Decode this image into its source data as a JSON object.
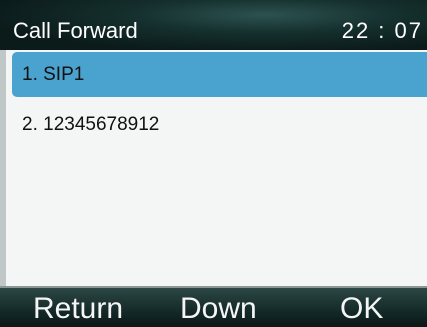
{
  "header": {
    "title": "Call Forward",
    "clock": "22 : 07"
  },
  "list": {
    "items": [
      {
        "label": "1. SIP1",
        "selected": true
      },
      {
        "label": "2. 12345678912",
        "selected": false
      }
    ]
  },
  "softkeys": {
    "left": "Return",
    "middle": "Down",
    "right": "OK"
  },
  "colors": {
    "selection": "#4aa3cf",
    "list_background": "#f4f6f5",
    "header_background": "#15302e",
    "softkey_background": "#152c2a",
    "text_light": "#ffffff",
    "text_dark": "#111111"
  }
}
